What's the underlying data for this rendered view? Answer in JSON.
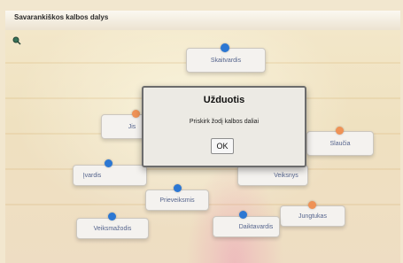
{
  "window": {
    "title": "Savarankiškos kalbos dalys"
  },
  "toolbar": {
    "icon": "magnifier-icon"
  },
  "words": [
    {
      "label": "Skaitvardis",
      "dot": "blue"
    },
    {
      "label": "Jis",
      "dot": "orange"
    },
    {
      "label": "Slaučia",
      "dot": "orange"
    },
    {
      "label": "Įvardis",
      "dot": "blue"
    },
    {
      "label": "Veiksmažodis",
      "dot": "blue"
    },
    {
      "label": "Prieveiksmis",
      "dot": "blue"
    },
    {
      "label": "Jungtukas",
      "dot": "orange"
    },
    {
      "label": "Veiksnys",
      "dot": "orange"
    },
    {
      "label": "Daiktavardis",
      "dot": "blue"
    }
  ],
  "dialog": {
    "title": "Užduotis",
    "message": "Priskirk žodį kalbos daliai",
    "ok_label": "OK"
  },
  "colors": {
    "blue_dot": "#1f6fd1",
    "orange_dot": "#ef8c4c",
    "card_text": "#4a5a86"
  }
}
